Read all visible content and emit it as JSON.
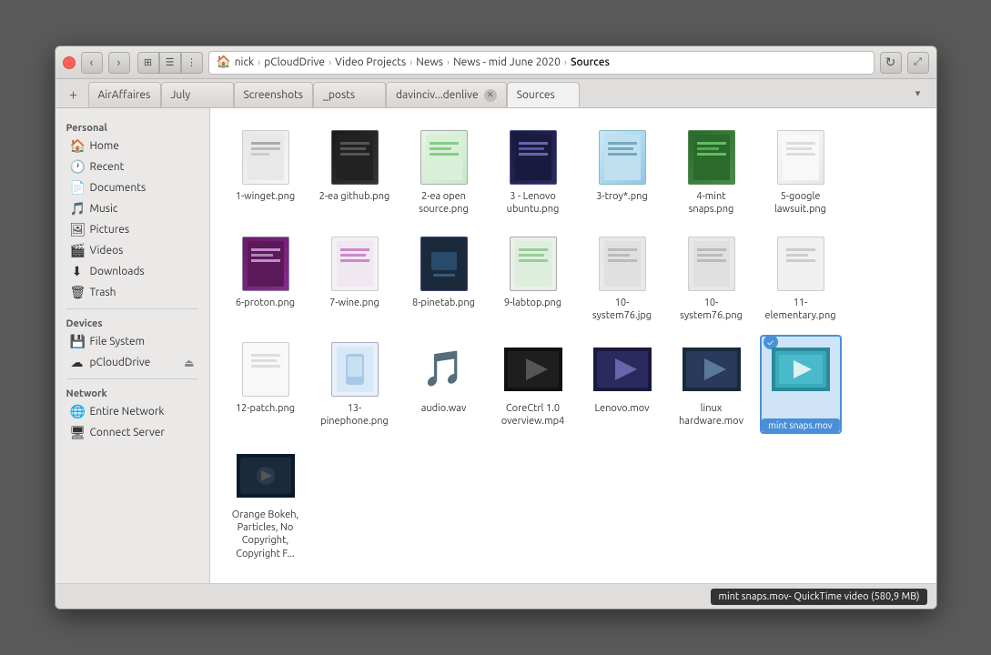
{
  "window": {
    "title": "Sources"
  },
  "titlebar": {
    "back_label": "‹",
    "forward_label": "›",
    "view_grid_label": "⊞",
    "view_list_label": "☰",
    "view_compact_label": "⋮",
    "refresh_label": "↻",
    "maximize_label": "⤢"
  },
  "breadcrumb": {
    "items": [
      {
        "label": "nick",
        "active": false
      },
      {
        "label": "pCloudDrive",
        "active": false
      },
      {
        "label": "Video Projects",
        "active": false
      },
      {
        "label": "News",
        "active": false
      },
      {
        "label": "News - mid June 2020",
        "active": false
      },
      {
        "label": "Sources",
        "active": true
      }
    ],
    "separator": "›"
  },
  "tabs": [
    {
      "label": "AirAffaires",
      "active": false,
      "closable": false
    },
    {
      "label": "July",
      "active": false,
      "closable": false
    },
    {
      "label": "Screenshots",
      "active": false,
      "closable": false
    },
    {
      "label": "_posts",
      "active": false,
      "closable": false
    },
    {
      "label": "davinciv...denlive",
      "active": false,
      "closable": true
    },
    {
      "label": "Sources",
      "active": true,
      "closable": false
    }
  ],
  "sidebar": {
    "personal_label": "Personal",
    "items_personal": [
      {
        "icon": "🏠",
        "label": "Home",
        "active": false
      },
      {
        "icon": "🕐",
        "label": "Recent",
        "active": false
      },
      {
        "icon": "📄",
        "label": "Documents",
        "active": false
      },
      {
        "icon": "🎵",
        "label": "Music",
        "active": false
      },
      {
        "icon": "🖼",
        "label": "Pictures",
        "active": false
      },
      {
        "icon": "🎬",
        "label": "Videos",
        "active": false
      },
      {
        "icon": "⬇",
        "label": "Downloads",
        "active": false
      },
      {
        "icon": "🗑",
        "label": "Trash",
        "active": false
      }
    ],
    "devices_label": "Devices",
    "items_devices": [
      {
        "icon": "💾",
        "label": "File System",
        "active": false
      },
      {
        "icon": "☁",
        "label": "pCloudDrive",
        "active": false,
        "eject": true
      }
    ],
    "network_label": "Network",
    "items_network": [
      {
        "icon": "🌐",
        "label": "Entire Network",
        "active": false
      },
      {
        "icon": "🖥",
        "label": "Connect Server",
        "active": false
      }
    ]
  },
  "files": [
    {
      "name": "1-winget.png",
      "type": "png",
      "thumb": "winget"
    },
    {
      "name": "2-ea github.png",
      "type": "png",
      "thumb": "github"
    },
    {
      "name": "2-ea open source.png",
      "type": "png",
      "thumb": "opensource"
    },
    {
      "name": "3 - Lenovo ubuntu.png",
      "type": "png",
      "thumb": "lenovo"
    },
    {
      "name": "3-troy*.png",
      "type": "png",
      "thumb": "troy"
    },
    {
      "name": "4-mint snaps.png",
      "type": "png",
      "thumb": "mint"
    },
    {
      "name": "5-google lawsuit.png",
      "type": "png",
      "thumb": "google"
    },
    {
      "name": "6-proton.png",
      "type": "png",
      "thumb": "proton"
    },
    {
      "name": "7-wine.png",
      "type": "png",
      "thumb": "wine"
    },
    {
      "name": "8-pinetab.png",
      "type": "png",
      "thumb": "pinetab"
    },
    {
      "name": "9-labtop.png",
      "type": "png",
      "thumb": "labtop"
    },
    {
      "name": "10-system76.jpg",
      "type": "png",
      "thumb": "system76"
    },
    {
      "name": "10-system76.png",
      "type": "png",
      "thumb": "system76"
    },
    {
      "name": "11-elementary.png",
      "type": "png",
      "thumb": "elementary"
    },
    {
      "name": "12-patch.png",
      "type": "png",
      "thumb": "patch"
    },
    {
      "name": "13-pinephone.png",
      "type": "png",
      "thumb": "pinephone"
    },
    {
      "name": "audio.wav",
      "type": "audio",
      "thumb": "audio"
    },
    {
      "name": "CoreCtrl 1.0 overview.mp4",
      "type": "video",
      "thumb": "corectrl"
    },
    {
      "name": "Lenovo.mov",
      "type": "video",
      "thumb": "lenovo"
    },
    {
      "name": "linux hardware.mov",
      "type": "video",
      "thumb": "linuxhw"
    },
    {
      "name": "mint snaps.mov",
      "type": "video",
      "thumb": "mintsnaps",
      "selected": true
    },
    {
      "name": "Orange Bokeh, Particles, No Copyright, Copyright F...",
      "type": "video",
      "thumb": "orange"
    }
  ],
  "statusbar": {
    "tooltip": "mint snaps.mov- QuickTime video (580,9 MB)"
  }
}
